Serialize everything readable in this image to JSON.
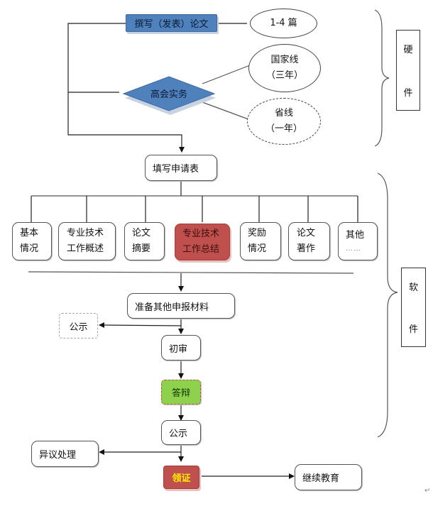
{
  "hardware": {
    "write_paper": "撰写（发表）论文",
    "paper_count": "1-4 篇",
    "senior_practice": "高会实务",
    "national_line": [
      "国家线",
      "（三年）"
    ],
    "provincial_line": [
      "省线",
      "（一年）"
    ],
    "side_label": [
      "硬",
      "件"
    ]
  },
  "application": {
    "form": "填写申请表",
    "items": [
      {
        "lines": [
          "基本",
          "情况"
        ],
        "highlight": false
      },
      {
        "lines": [
          "专业技术",
          "工作概述"
        ],
        "highlight": false
      },
      {
        "lines": [
          "论文",
          "摘要"
        ],
        "highlight": false
      },
      {
        "lines": [
          "专业技术",
          "工作总结"
        ],
        "highlight": true
      },
      {
        "lines": [
          "奖励",
          "情况"
        ],
        "highlight": false
      },
      {
        "lines": [
          "论文",
          "著作"
        ],
        "highlight": false
      },
      {
        "lines": [
          "其他",
          "……"
        ],
        "highlight": false
      }
    ]
  },
  "process": {
    "prepare": "准备其他申报材料",
    "publicity_side": "公示",
    "preliminary": "初审",
    "defense": "答辩",
    "publicity": "公示",
    "objection": "异议处理",
    "certificate": "领证",
    "continuing_education": "继续教育"
  },
  "software": {
    "side_label": [
      "软",
      "件"
    ]
  },
  "paragraph_mark": "↵",
  "colors": {
    "blue": "#4f81bd",
    "red": "#c0504d",
    "green": "#8ed14d",
    "certificate_text": "#ffee00"
  }
}
